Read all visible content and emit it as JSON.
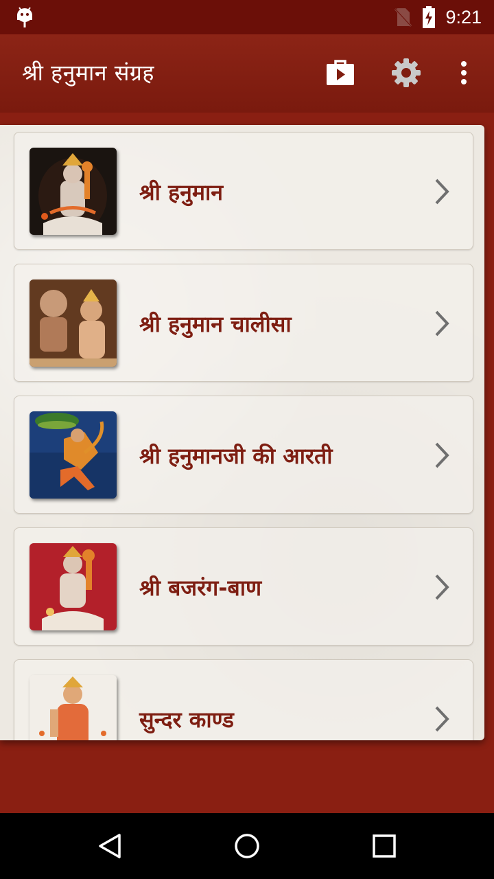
{
  "status_bar": {
    "time": "9:21",
    "icons": [
      "android-debug-icon",
      "no-sim-icon",
      "battery-charging-icon"
    ]
  },
  "app_bar": {
    "title": "श्री हनुमान संग्रह",
    "actions": [
      "play-store-icon",
      "gear-icon",
      "more-vert-icon"
    ]
  },
  "list": {
    "items": [
      {
        "label": "श्री हनुमान",
        "thumb": "hanuman-seated-image"
      },
      {
        "label": "श्री हनुमान चालीसा",
        "thumb": "ram-hanuman-image"
      },
      {
        "label": "श्री हनुमानजी की आरती",
        "thumb": "hanuman-flying-mountain-image"
      },
      {
        "label": "श्री बजरंग-बाण",
        "thumb": "hanuman-seated-red-image"
      },
      {
        "label": "सुन्दर काण्ड",
        "thumb": "hanuman-standing-image"
      }
    ]
  },
  "colors": {
    "status_bar": "#6b0f08",
    "app_bar": "#7f1d10",
    "background": "#8a1f12",
    "label_text": "#7e1e12",
    "panel": "#ede9e2"
  },
  "nav_bar": {
    "buttons": [
      "back-icon",
      "home-icon",
      "recents-icon"
    ]
  }
}
